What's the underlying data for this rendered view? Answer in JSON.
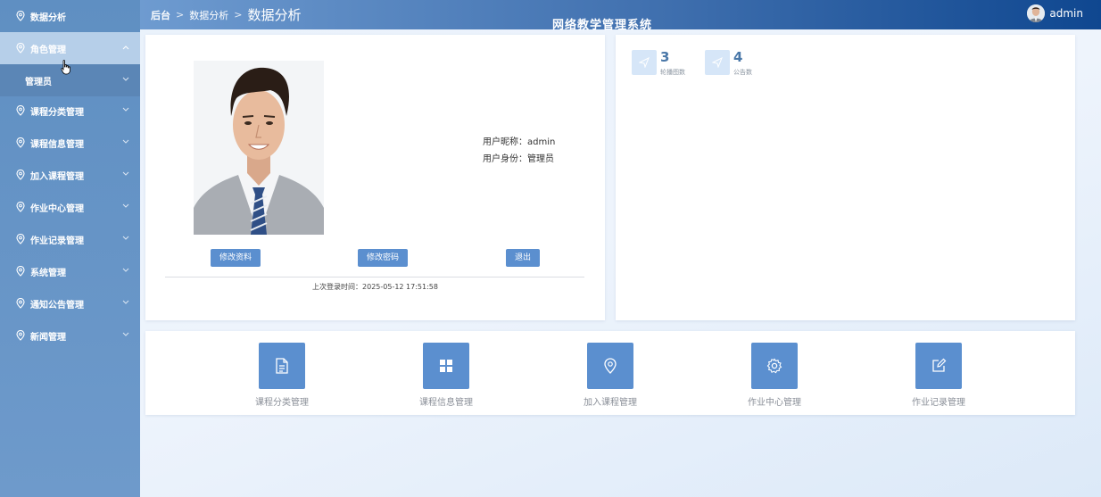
{
  "sidebar": {
    "items": [
      {
        "label": "数据分析"
      },
      {
        "label": "角色管理"
      },
      {
        "label": "管理员"
      },
      {
        "label": "课程分类管理"
      },
      {
        "label": "课程信息管理"
      },
      {
        "label": "加入课程管理"
      },
      {
        "label": "作业中心管理"
      },
      {
        "label": "作业记录管理"
      },
      {
        "label": "系统管理"
      },
      {
        "label": "通知公告管理"
      },
      {
        "label": "新闻管理"
      }
    ]
  },
  "header": {
    "breadcrumb": [
      "后台",
      "数据分析",
      "数据分析"
    ],
    "system_title": "网络教学管理系统",
    "username": "admin"
  },
  "profile": {
    "nickname_line": "用户昵称：admin",
    "role_line": "用户身份：管理员",
    "edit_profile_label": "修改资料",
    "change_password_label": "修改密码",
    "logout_label": "退出",
    "last_login": "上次登录时间：2025-05-12 17:51:58"
  },
  "stats": [
    {
      "value": "3",
      "label": "轮播图数",
      "icon": "send-icon"
    },
    {
      "value": "4",
      "label": "公告数",
      "icon": "send-icon"
    }
  ],
  "quick_links": [
    {
      "label": "课程分类管理",
      "icon": "document-icon"
    },
    {
      "label": "课程信息管理",
      "icon": "grid-icon"
    },
    {
      "label": "加入课程管理",
      "icon": "location-pin-icon"
    },
    {
      "label": "作业中心管理",
      "icon": "gear-icon"
    },
    {
      "label": "作业记录管理",
      "icon": "edit-icon"
    }
  ],
  "colors": {
    "accent": "#5b8fcf",
    "sidebar": "#6e9acb",
    "header_dark": "#0f4790"
  }
}
